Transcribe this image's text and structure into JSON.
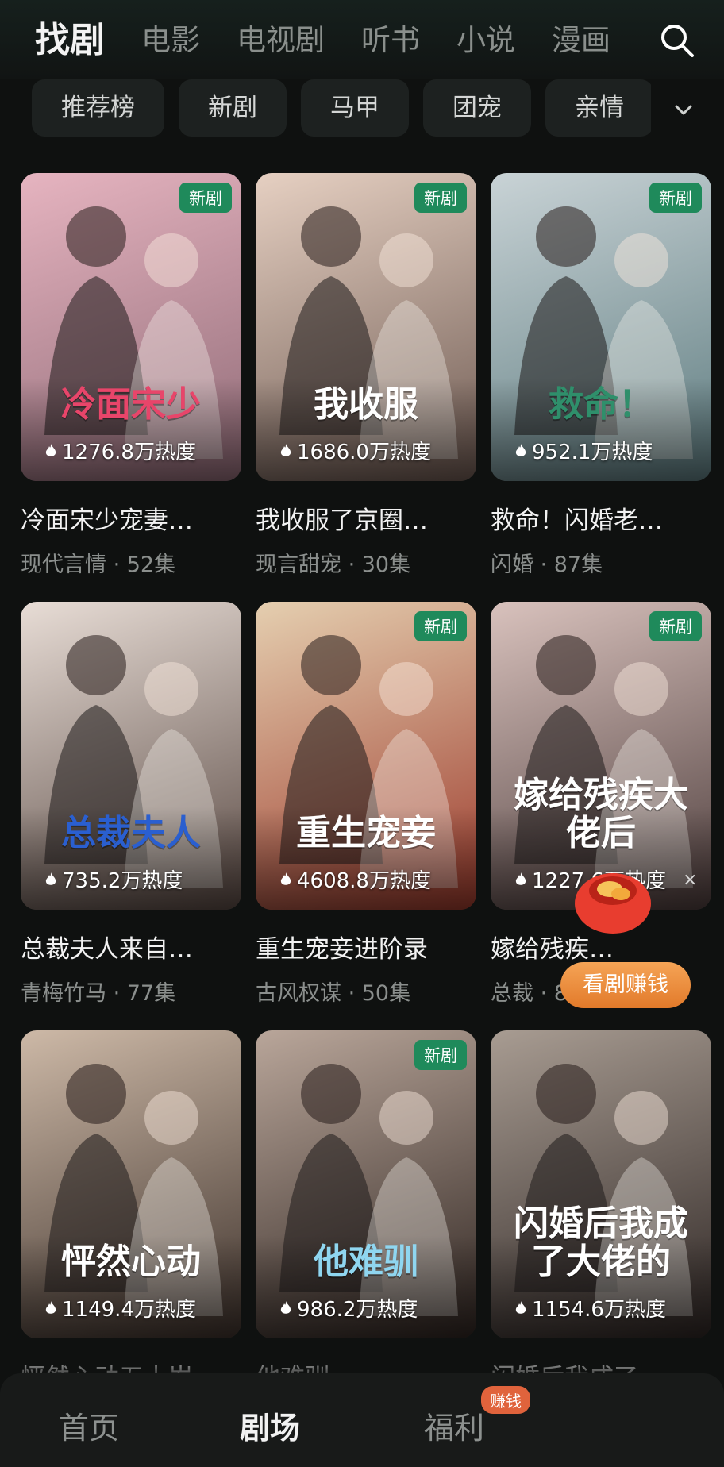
{
  "header": {
    "tabs": [
      "找剧",
      "电影",
      "电视剧",
      "听书",
      "小说",
      "漫画"
    ],
    "active_tab": "找剧",
    "search_icon": "search-icon"
  },
  "chips": [
    "推荐榜",
    "新剧",
    "马甲",
    "团宠",
    "亲情"
  ],
  "badge_text": "新剧",
  "cards": [
    {
      "poster_title": "冷面宋少",
      "heat": "1276.8万热度",
      "title": "冷面宋少宠妻…",
      "meta": "现代言情 · 52集",
      "new": true,
      "colors": [
        "#e6b4c0",
        "#8f6a76"
      ],
      "title_color": "#e8456a"
    },
    {
      "poster_title": "我收服",
      "heat": "1686.0万热度",
      "title": "我收服了京圈…",
      "meta": "现言甜宠 · 30集",
      "new": true,
      "colors": [
        "#e6d0c2",
        "#6e5a52"
      ],
      "title_color": "#ffffff"
    },
    {
      "poster_title": "救命！",
      "heat": "952.1万热度",
      "title": "救命！闪婚老…",
      "meta": "闪婚 · 87集",
      "new": true,
      "colors": [
        "#c9d3d6",
        "#5e7c80"
      ],
      "title_color": "#2f8f6b"
    },
    {
      "poster_title": "总裁夫人",
      "heat": "735.2万热度",
      "title": "总裁夫人来自…",
      "meta": "青梅竹马 · 77集",
      "new": false,
      "colors": [
        "#e8ddd6",
        "#5a4a44"
      ],
      "title_color": "#2a5fd0"
    },
    {
      "poster_title": "重生宠妾",
      "heat": "4608.8万热度",
      "title": "重生宠妾进阶录",
      "meta": "古风权谋 · 50集",
      "new": true,
      "colors": [
        "#e5cfb0",
        "#9c3a2c"
      ],
      "title_color": "#ffffff"
    },
    {
      "poster_title": "嫁给残疾大佬后",
      "heat": "1227.6万热度",
      "title": "嫁给残疾…",
      "meta": "总裁 · 80集",
      "new": true,
      "colors": [
        "#d9c2bd",
        "#4e3e3d"
      ],
      "title_color": "#ffffff"
    },
    {
      "poster_title": "怦然心动",
      "heat": "1149.4万热度",
      "title": "怦然心动五十岁",
      "meta": "",
      "new": false,
      "colors": [
        "#cdb9a7",
        "#3e322c"
      ],
      "title_color": "#ffffff"
    },
    {
      "poster_title": "他难驯",
      "heat": "986.2万热度",
      "title": "他难驯",
      "meta": "",
      "new": true,
      "colors": [
        "#b9a69a",
        "#2f2521"
      ],
      "title_color": "#8fd6f0"
    },
    {
      "poster_title": "闪婚后我成了大佬的",
      "heat": "1154.6万热度",
      "title": "闪婚后我成了…",
      "meta": "",
      "new": false,
      "colors": [
        "#a89c92",
        "#2e2624"
      ],
      "title_color": "#ffffff"
    }
  ],
  "floating": {
    "button": "看剧赚钱",
    "close": "×"
  },
  "bottom_nav": {
    "items": [
      "首页",
      "剧场",
      "福利"
    ],
    "active": "剧场",
    "earn_badge": "赚钱"
  }
}
